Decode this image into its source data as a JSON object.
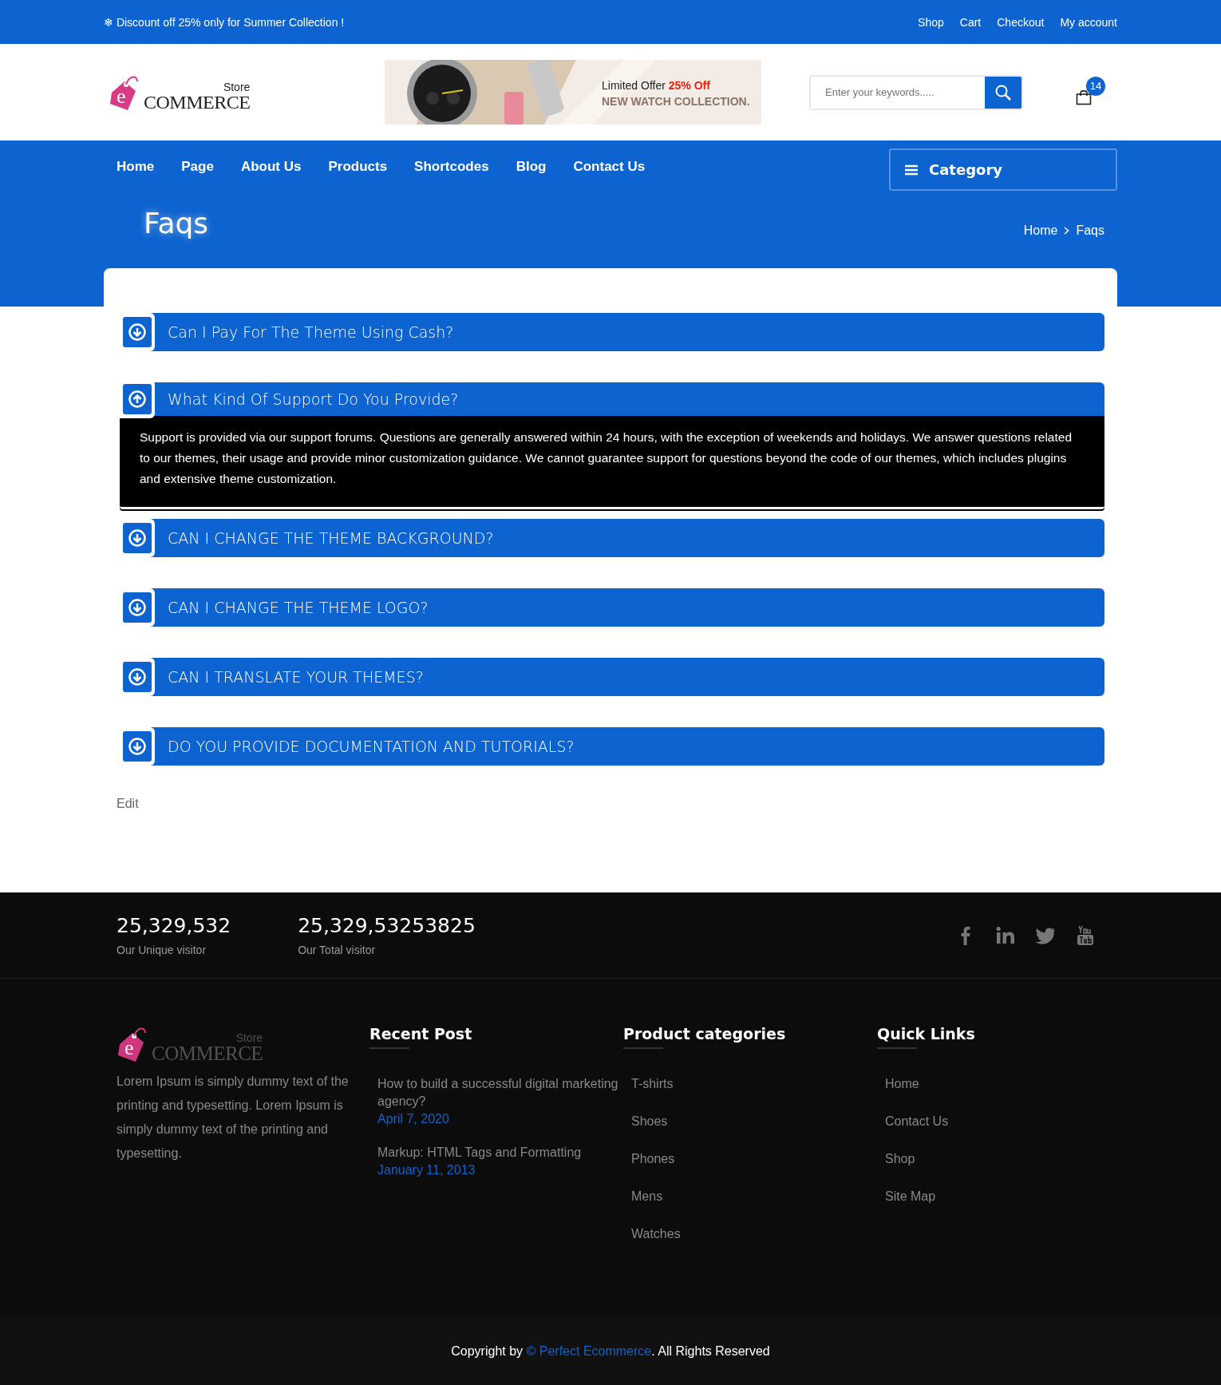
{
  "top_bar": {
    "promo_icon": "❄",
    "promo": "Discount off 25% only for Summer Collection !",
    "links": [
      "Shop",
      "Cart",
      "Checkout",
      "My account"
    ]
  },
  "header": {
    "logo": {
      "small": "Store",
      "main": "COMMERCE",
      "letter": "e"
    },
    "banner": {
      "line1": "Limited Offer ",
      "highlight": "25% Off",
      "line2": "NEW WATCH COLLECTION."
    },
    "search": {
      "placeholder": "Enter your keywords....."
    },
    "cart_count": "14"
  },
  "nav": {
    "items": [
      "Home",
      "Page",
      "About Us",
      "Products",
      "Shortcodes",
      "Blog",
      "Contact Us"
    ],
    "category": "Category"
  },
  "page_title": "Faqs",
  "breadcrumb": [
    "Home",
    "Faqs"
  ],
  "faqs": [
    {
      "question": "Can I Pay For The Theme Using Cash?",
      "expanded": false
    },
    {
      "question": "What Kind Of Support Do You Provide?",
      "expanded": true,
      "answer": "Support is provided via our support forums. Questions are generally answered within 24 hours, with the exception of weekends and holidays. We answer questions related to our themes, their usage and provide minor customization guidance. We cannot guarantee support for questions beyond the code of our themes, which includes plugins and extensive theme customization."
    },
    {
      "question": "CAN I CHANGE THE THEME BACKGROUND?",
      "expanded": false
    },
    {
      "question": "CAN I CHANGE THE THEME LOGO?",
      "expanded": false
    },
    {
      "question": "CAN I TRANSLATE YOUR THEMES?",
      "expanded": false
    },
    {
      "question": "DO YOU PROVIDE DOCUMENTATION AND TUTORIALS?",
      "expanded": false
    }
  ],
  "edit_link": "Edit",
  "stats": [
    {
      "value": "25,329,532",
      "label": "Our Unique visitor"
    },
    {
      "value": "25,329,53253825",
      "label": "Our Total visitor"
    }
  ],
  "social": [
    {
      "kind": "facebook"
    },
    {
      "kind": "linkedin"
    },
    {
      "kind": "twitter"
    },
    {
      "kind": "youtube"
    }
  ],
  "footer": {
    "logo": {
      "small": "Store",
      "main": "COMMERCE",
      "letter": "e"
    },
    "about": "Lorem Ipsum is simply dummy text of the printing and typesetting. Lorem Ipsum is simply dummy text of the printing and typesetting.",
    "recent_post": {
      "title": "Recent Post",
      "posts": [
        {
          "title": "How to build a successful digital marketing agency?",
          "date": "April 7, 2020"
        },
        {
          "title": "Markup: HTML Tags and Formatting",
          "date": "January 11, 2013"
        }
      ]
    },
    "categories": {
      "title": "Product categories",
      "items": [
        "T-shirts",
        "Shoes",
        "Phones",
        "Mens",
        "Watches"
      ]
    },
    "quick_links": {
      "title": "Quick Links",
      "items": [
        "Home",
        "Contact Us",
        "Shop",
        "Site Map"
      ]
    }
  },
  "copyright": {
    "before": "Copyright by ",
    "link": "© Perfect Ecommerce",
    "after": ". All Rights Reserved"
  }
}
